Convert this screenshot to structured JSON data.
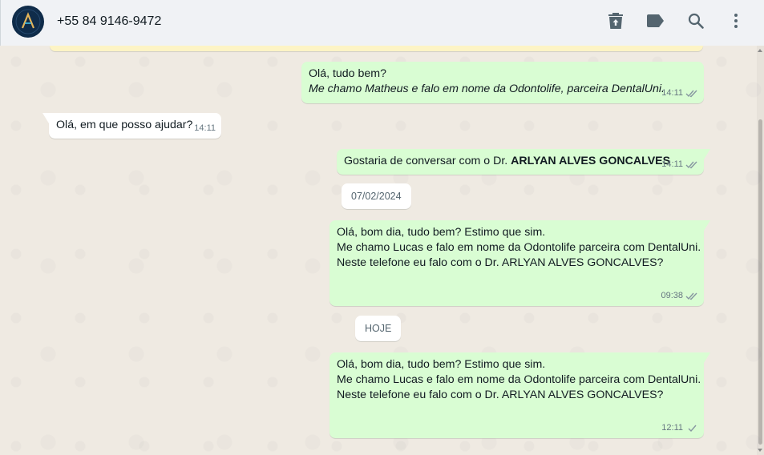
{
  "header": {
    "contact_name": "+55 84 9146-9472",
    "icons": [
      "delete-icon",
      "label-icon",
      "search-icon",
      "menu-icon"
    ]
  },
  "colors": {
    "header_bg": "#f0f2f5",
    "chat_bg": "#efeae2",
    "outgoing_bubble": "#d9fdd3",
    "incoming_bubble": "#ffffff",
    "read_tick": "#53bdeb",
    "meta_text": "#667781"
  },
  "messages": [
    {
      "direction": "out",
      "line1": "Olá, tudo bem?",
      "line2": "Me chamo Matheus e falo em nome da Odontolife, parceira DentalUni.",
      "time": "14:11",
      "status": "double-tick"
    },
    {
      "direction": "in",
      "text": "Olá, em que posso ajudar?",
      "time": "14:11"
    },
    {
      "direction": "out",
      "text_prefix": "Gostaria de conversar com o Dr. ",
      "text_bold": "ARLYAN ALVES GONCALVES",
      "time": "14:11",
      "status": "double-tick"
    },
    {
      "direction": "out",
      "line1": "Olá, bom dia, tudo bem? Estimo que sim.",
      "line2": "Me chamo Lucas e falo em nome da Odontolife parceira com DentalUni.",
      "line3": "Neste telefone eu falo com o Dr. ARLYAN ALVES GONCALVES?",
      "time": "09:38",
      "status": "double-tick"
    },
    {
      "direction": "out",
      "line1": "Olá, bom dia, tudo bem? Estimo que sim.",
      "line2": "Me chamo Lucas e falo em nome da Odontolife parceira com DentalUni.",
      "line3": "Neste telefone eu falo com o Dr. ARLYAN ALVES GONCALVES?",
      "time": "12:11",
      "status": "single-tick"
    }
  ],
  "date_separators": {
    "first": "07/02/2024",
    "second": "HOJE"
  }
}
